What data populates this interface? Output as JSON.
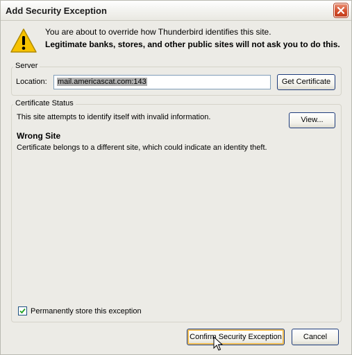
{
  "window": {
    "title": "Add Security Exception"
  },
  "warning": {
    "line1": "You are about to override how Thunderbird identifies this site.",
    "line2": "Legitimate banks, stores, and other public sites will not ask you to do this."
  },
  "server": {
    "group_label": "Server",
    "location_label": "Location:",
    "location_value": "mail.americascat.com:143",
    "get_certificate_label": "Get Certificate"
  },
  "certificate_status": {
    "group_label": "Certificate Status",
    "status_text": "This site attempts to identify itself with invalid information.",
    "view_label": "View...",
    "problem_title": "Wrong Site",
    "problem_description": "Certificate belongs to a different site, which could indicate an identity theft."
  },
  "permanent_store": {
    "label": "Permanently store this exception",
    "checked": true
  },
  "buttons": {
    "confirm_label": "Confirm Security Exception",
    "cancel_label": "Cancel"
  },
  "icons": {
    "warning": "warning-icon",
    "close": "close-icon",
    "checkmark": "checkmark-icon",
    "cursor": "mouse-cursor-icon"
  },
  "colors": {
    "window_bg": "#ecebe6",
    "close_button": "#d4502e",
    "warning_yellow": "#f7c200",
    "selection_highlight": "#b0b0b0"
  }
}
